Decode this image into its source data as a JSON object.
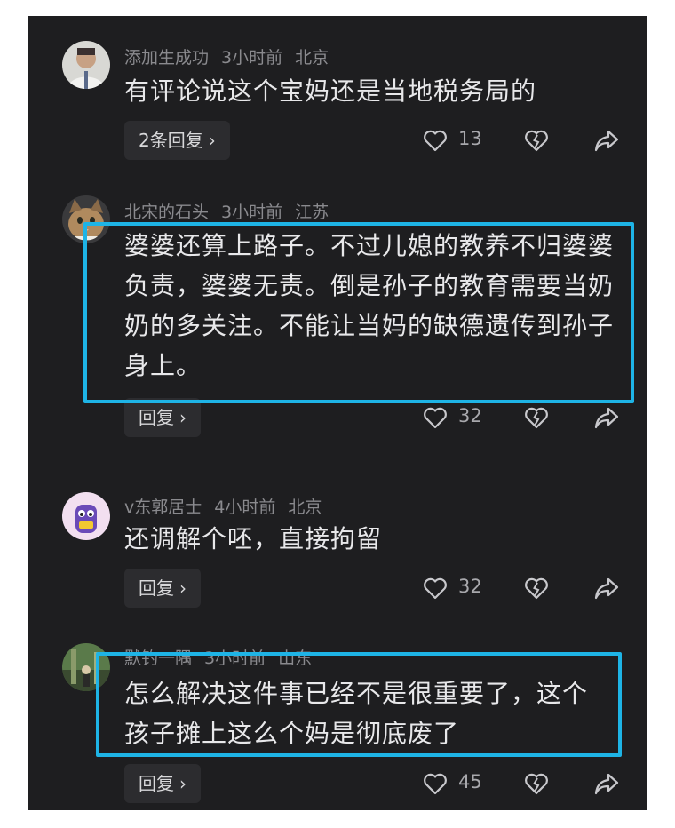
{
  "comments": [
    {
      "username": "添加生成功",
      "time": "3小时前",
      "location": "北京",
      "text": "有评论说这个宝妈还是当地税务局的",
      "reply_label": "2条回复",
      "likes": "13",
      "highlighted": false
    },
    {
      "username": "北宋的石头",
      "time": "3小时前",
      "location": "江苏",
      "text": "婆婆还算上路子。不过儿媳的教养不归婆婆负责，婆婆无责。倒是孙子的教育需要当奶奶的多关注。不能让当妈的缺德遗传到孙子身上。",
      "reply_label": "回复",
      "likes": "32",
      "highlighted": true
    },
    {
      "username": "v东郭居士",
      "time": "4小时前",
      "location": "北京",
      "text": "还调解个呸，直接拘留",
      "reply_label": "回复",
      "likes": "32",
      "highlighted": false
    },
    {
      "username": "默钓一隅",
      "time": "3小时前",
      "location": "山东",
      "text": "怎么解决这件事已经不是很重要了，这个孩子摊上这么个妈是彻底废了",
      "reply_label": "回复",
      "likes": "45",
      "highlighted": true
    }
  ],
  "icons": {
    "like": "heart-outline-icon",
    "dislike": "broken-heart-icon",
    "share": "share-arrow-icon",
    "reply_chevron": "chevron-right-icon"
  },
  "colors": {
    "background": "#1e1e20",
    "highlight": "#1eb4e6",
    "text": "#e8e8ea",
    "meta": "#8a8a8e"
  }
}
